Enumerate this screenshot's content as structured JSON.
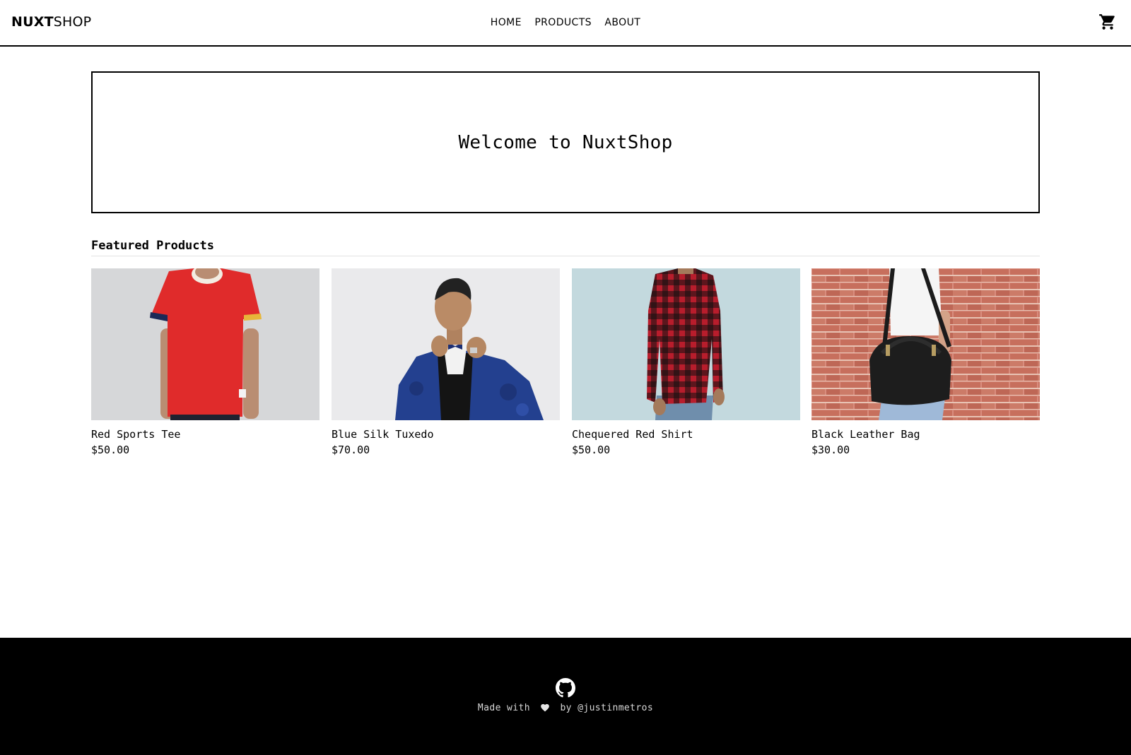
{
  "header": {
    "logo_bold": "NUXT",
    "logo_light": "SHOP",
    "nav": [
      "HOME",
      "PRODUCTS",
      "ABOUT"
    ],
    "cart_icon": "cart-icon"
  },
  "hero": {
    "title": "Welcome to NuxtShop"
  },
  "featured": {
    "title": "Featured Products",
    "products": [
      {
        "name": "Red Sports Tee",
        "price": "$50.00"
      },
      {
        "name": "Blue Silk Tuxedo",
        "price": "$70.00"
      },
      {
        "name": "Chequered Red Shirt",
        "price": "$50.00"
      },
      {
        "name": "Black Leather Bag",
        "price": "$30.00"
      }
    ]
  },
  "footer": {
    "made_with": "Made with",
    "by": "by @justinmetros",
    "icons": [
      "github-icon",
      "heart-icon"
    ]
  }
}
